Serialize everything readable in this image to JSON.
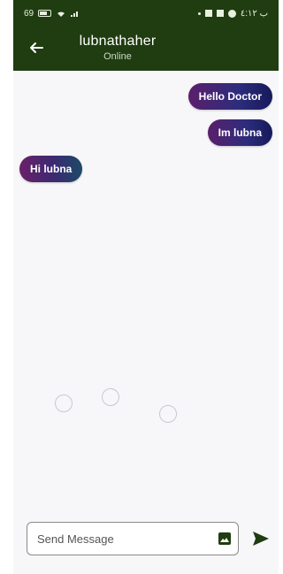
{
  "status_bar": {
    "left_text": "69",
    "right_text": "ب ٤:١٢"
  },
  "header": {
    "title": "lubnathaher",
    "subtitle": "Online"
  },
  "messages": [
    {
      "text": "Hello Doctor",
      "side": "right"
    },
    {
      "text": "Im lubna",
      "side": "right"
    },
    {
      "text": "Hi lubna",
      "side": "left"
    }
  ],
  "composer": {
    "placeholder": "Send Message"
  },
  "colors": {
    "header_bg": "#1f3d10",
    "bubble_start": "#5a1f6b",
    "bubble_end": "#16195a"
  },
  "icons": [
    "back-arrow-icon",
    "image-icon",
    "send-icon"
  ]
}
